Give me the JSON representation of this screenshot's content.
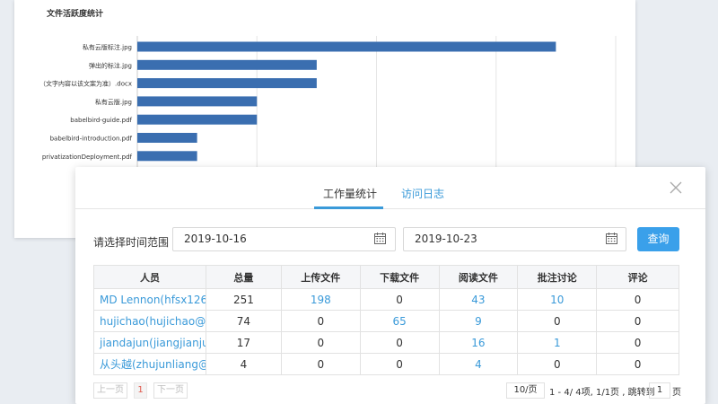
{
  "chart": {
    "title": "文件活跃度统计"
  },
  "chart_data": {
    "type": "bar",
    "orientation": "horizontal",
    "title": "文件活跃度统计",
    "categories": [
      "私有云版标注.jpg",
      "弹出的标注.jpg",
      "（文字内容以该文案为准）.docx",
      "私有云版.jpg",
      "babelbird-guide.pdf",
      "babelbird-introduction.pdf",
      "privatizationDeployment.pdf"
    ],
    "values": [
      7,
      3,
      3,
      2,
      2,
      1,
      1
    ],
    "xlim": [
      0,
      8
    ],
    "bar_color": "#3a6eb0",
    "grid": true
  },
  "modal": {
    "tabs": [
      {
        "label": "工作量统计",
        "active": true
      },
      {
        "label": "访问日志",
        "active": false
      }
    ],
    "filter": {
      "label": "请选择时间范围",
      "start_date": "2019-10-16",
      "end_date": "2019-10-23",
      "query_label": "查询"
    },
    "table": {
      "headers": [
        "人员",
        "总量",
        "上传文件",
        "下载文件",
        "阅读文件",
        "批注讨论",
        "评论"
      ],
      "rows": [
        {
          "name": "MD Lennon(hfsx126...",
          "total": "251",
          "upload": "198",
          "download": "0",
          "read": "43",
          "annotate": "10",
          "comment": "0"
        },
        {
          "name": "hujichao(hujichao@...",
          "total": "74",
          "upload": "0",
          "download": "65",
          "read": "9",
          "annotate": "0",
          "comment": "0"
        },
        {
          "name": "jiandajun(jiangjianju...",
          "total": "17",
          "upload": "0",
          "download": "0",
          "read": "16",
          "annotate": "1",
          "comment": "0"
        },
        {
          "name": "从头越(zhujunliang@...",
          "total": "4",
          "upload": "0",
          "download": "0",
          "read": "4",
          "annotate": "0",
          "comment": "0"
        }
      ]
    },
    "pager": {
      "prev": "上一页",
      "current": "1",
      "next": "下一页",
      "page_size": "10/页",
      "info": "1 - 4/ 4项, 1/1页 , 跳转到",
      "jump_value": "1",
      "jump_suffix": "页"
    }
  },
  "colors": {
    "accent": "#3a9ad9",
    "button": "#3aa0ea",
    "bar": "#3a6eb0"
  }
}
